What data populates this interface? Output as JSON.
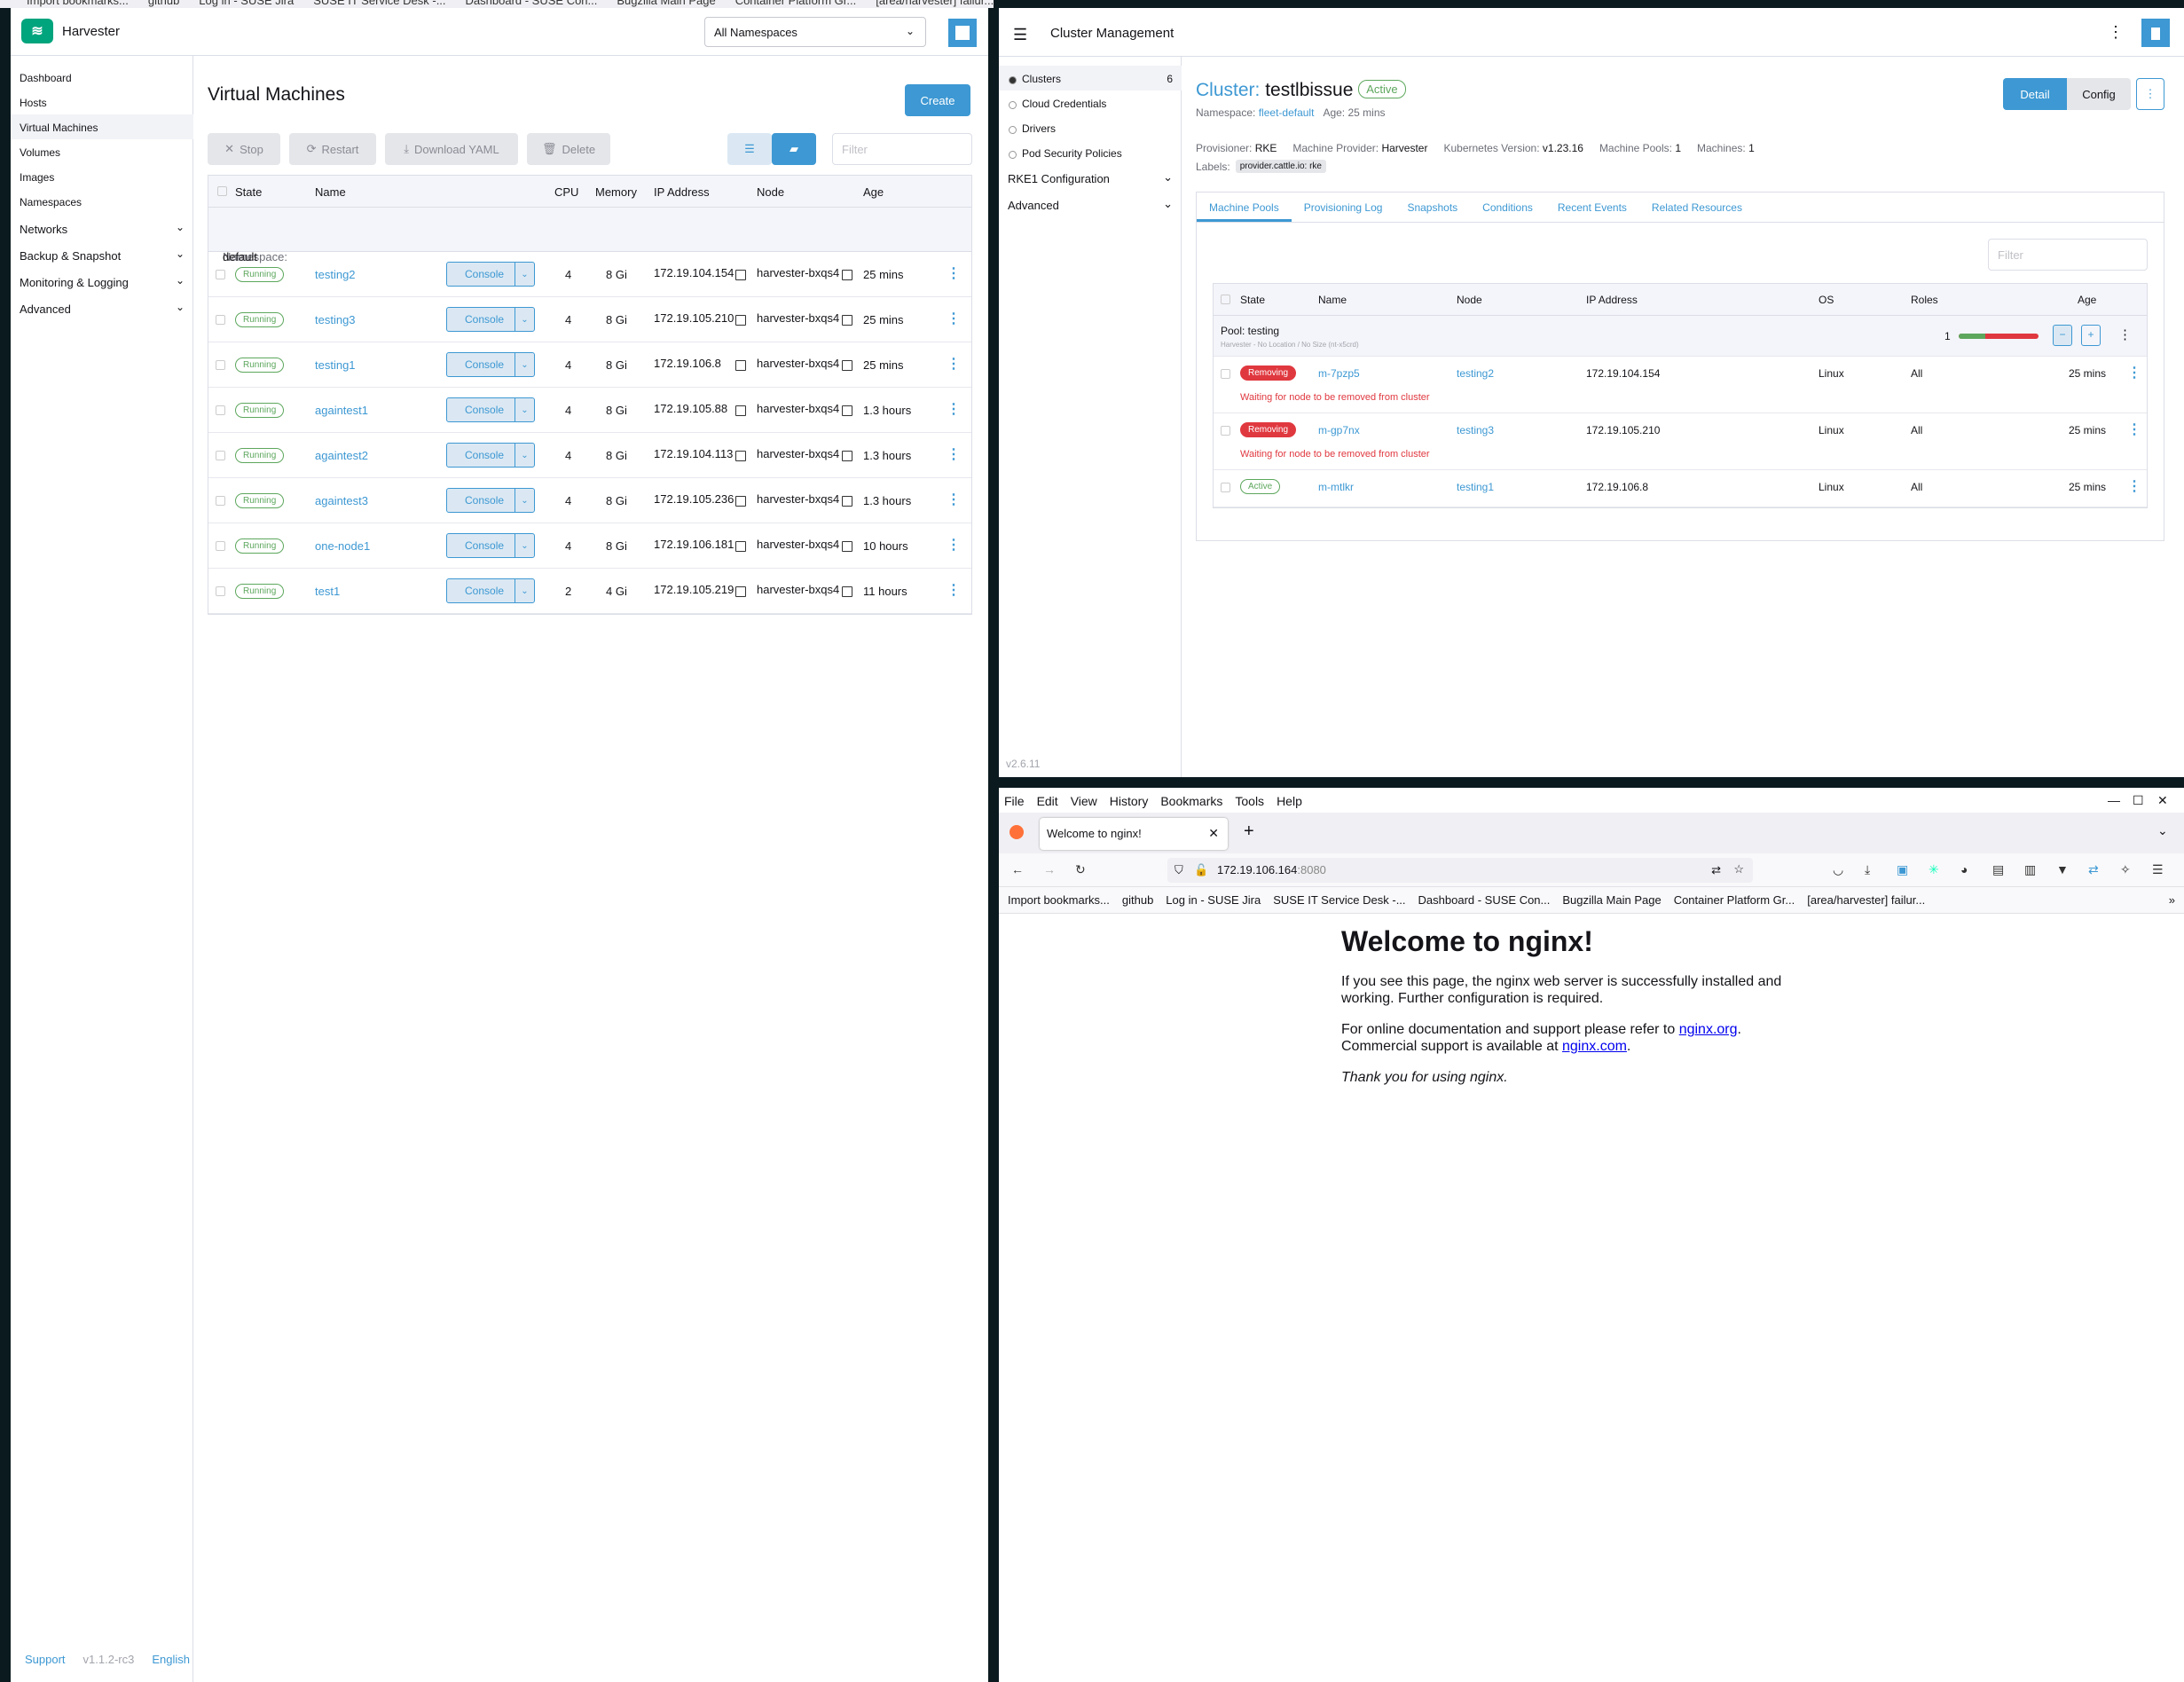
{
  "top_bookmarks": [
    "Import bookmarks...",
    "github",
    "Log in - SUSE Jira",
    "SUSE IT Service Desk -...",
    "Dashboard - SUSE Con...",
    "Bugzilla Main Page",
    "Container Platform Gr...",
    "[area/harvester] failur..."
  ],
  "harvester": {
    "title": "Harvester",
    "namespace_select": "All Namespaces",
    "nav": [
      "Dashboard",
      "Hosts",
      "Virtual Machines",
      "Volumes",
      "Images",
      "Namespaces"
    ],
    "nav_groups": [
      "Networks",
      "Backup & Snapshot",
      "Monitoring & Logging",
      "Advanced"
    ],
    "footer": {
      "support": "Support",
      "version": "v1.1.2-rc3",
      "language": "English"
    },
    "page_title": "Virtual Machines",
    "create": "Create",
    "actions": {
      "stop": "Stop",
      "restart": "Restart",
      "download": "Download YAML",
      "delete": "Delete"
    },
    "filter_placeholder": "Filter",
    "columns": [
      "State",
      "Name",
      "CPU",
      "Memory",
      "IP Address",
      "Node",
      "Age"
    ],
    "namespace_label": "Namespace:",
    "namespace_value": "default",
    "console_label": "Console",
    "vms": [
      {
        "state": "Running",
        "name": "testing2",
        "cpu": "4",
        "mem": "8 Gi",
        "ip": "172.19.104.154",
        "node": "harvester-bxqs4",
        "age": "25 mins"
      },
      {
        "state": "Running",
        "name": "testing3",
        "cpu": "4",
        "mem": "8 Gi",
        "ip": "172.19.105.210",
        "node": "harvester-bxqs4",
        "age": "25 mins"
      },
      {
        "state": "Running",
        "name": "testing1",
        "cpu": "4",
        "mem": "8 Gi",
        "ip": "172.19.106.8",
        "node": "harvester-bxqs4",
        "age": "25 mins"
      },
      {
        "state": "Running",
        "name": "againtest1",
        "cpu": "4",
        "mem": "8 Gi",
        "ip": "172.19.105.88",
        "node": "harvester-bxqs4",
        "age": "1.3 hours"
      },
      {
        "state": "Running",
        "name": "againtest2",
        "cpu": "4",
        "mem": "8 Gi",
        "ip": "172.19.104.113",
        "node": "harvester-bxqs4",
        "age": "1.3 hours"
      },
      {
        "state": "Running",
        "name": "againtest3",
        "cpu": "4",
        "mem": "8 Gi",
        "ip": "172.19.105.236",
        "node": "harvester-bxqs4",
        "age": "1.3 hours"
      },
      {
        "state": "Running",
        "name": "one-node1",
        "cpu": "4",
        "mem": "8 Gi",
        "ip": "172.19.106.181",
        "node": "harvester-bxqs4",
        "age": "10 hours"
      },
      {
        "state": "Running",
        "name": "test1",
        "cpu": "2",
        "mem": "4 Gi",
        "ip": "172.19.105.219",
        "node": "harvester-bxqs4",
        "age": "11 hours"
      }
    ]
  },
  "cluster": {
    "title": "Cluster Management",
    "nav": {
      "clusters": "Clusters",
      "clusters_count": "6",
      "cloud": "Cloud Credentials",
      "drivers": "Drivers",
      "psp": "Pod Security Policies",
      "rke1": "RKE1 Configuration",
      "advanced": "Advanced"
    },
    "version": "v2.6.11",
    "heading_prefix": "Cluster:",
    "name": "testlbissue",
    "status": "Active",
    "namespace_label": "Namespace:",
    "namespace": "fleet-default",
    "age_text": "Age: 25 mins",
    "detail_btn": "Detail",
    "config_btn": "Config",
    "info": [
      {
        "k": "Provisioner:",
        "v": "RKE"
      },
      {
        "k": "Machine Provider:",
        "v": "Harvester"
      },
      {
        "k": "Kubernetes Version:",
        "v": "v1.23.16"
      },
      {
        "k": "Machine Pools:",
        "v": "1"
      },
      {
        "k": "Machines:",
        "v": "1"
      }
    ],
    "labels_key": "Labels:",
    "label": "provider.cattle.io: rke",
    "tabs": [
      "Machine Pools",
      "Provisioning Log",
      "Snapshots",
      "Conditions",
      "Recent Events",
      "Related Resources"
    ],
    "filter_placeholder": "Filter",
    "columns": [
      "State",
      "Name",
      "Node",
      "IP Address",
      "OS",
      "Roles",
      "Age"
    ],
    "pool_name": "Pool: testing",
    "pool_sub": "Harvester - No Location / No Size (nt-x5crd)",
    "pool_count": "1",
    "pool_progress_fraction": 0.33,
    "machines": [
      {
        "state": "Removing",
        "name": "m-7pzp5",
        "node": "testing2",
        "ip": "172.19.104.154",
        "os": "Linux",
        "roles": "All",
        "age": "25 mins",
        "warn": "Waiting for node to be removed from cluster"
      },
      {
        "state": "Removing",
        "name": "m-gp7nx",
        "node": "testing3",
        "ip": "172.19.105.210",
        "os": "Linux",
        "roles": "All",
        "age": "25 mins",
        "warn": "Waiting for node to be removed from cluster"
      },
      {
        "state": "Active",
        "name": "m-mtlkr",
        "node": "testing1",
        "ip": "172.19.106.8",
        "os": "Linux",
        "roles": "All",
        "age": "25 mins",
        "warn": ""
      }
    ]
  },
  "firefox": {
    "menu": [
      "File",
      "Edit",
      "View",
      "History",
      "Bookmarks",
      "Tools",
      "Help"
    ],
    "tab_title": "Welcome to nginx!",
    "url_host": "172.19.106.164",
    "url_port": ":8080",
    "bookmarks": [
      "Import bookmarks...",
      "github",
      "Log in - SUSE Jira",
      "SUSE IT Service Desk -...",
      "Dashboard - SUSE Con...",
      "Bugzilla Main Page",
      "Container Platform Gr...",
      "[area/harvester] failur..."
    ],
    "page": {
      "h1": "Welcome to nginx!",
      "p1": "If you see this page, the nginx web server is successfully installed and working. Further configuration is required.",
      "p2a": "For online documentation and support please refer to ",
      "link1": "nginx.org",
      "p2b": ".",
      "p2c": "Commercial support is available at ",
      "link2": "nginx.com",
      "p2d": ".",
      "p3": "Thank you for using nginx."
    }
  }
}
